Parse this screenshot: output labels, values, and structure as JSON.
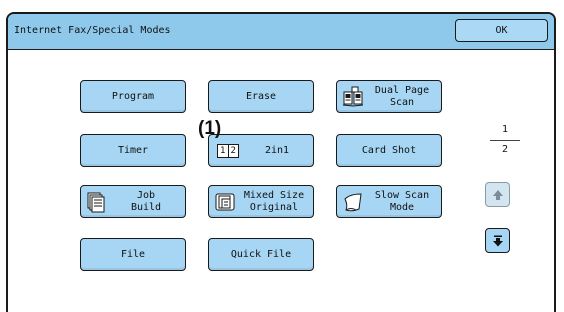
{
  "window": {
    "title": "Internet Fax/Special Modes",
    "ok_label": "OK"
  },
  "buttons": {
    "program": "Program",
    "erase": "Erase",
    "dual_page_scan": "Dual Page\nScan",
    "timer": "Timer",
    "twoin1": "2in1",
    "card_shot": "Card Shot",
    "job_build": "Job\nBuild",
    "mixed_size_original": "Mixed Size\nOriginal",
    "slow_scan_mode": "Slow Scan\nMode",
    "file": "File",
    "quick_file": "Quick File"
  },
  "twoin1_icon": {
    "left": "1",
    "right": "2"
  },
  "callout": "(1)",
  "pagination": {
    "current": "1",
    "total": "2",
    "up_enabled": false,
    "down_enabled": true
  },
  "icons": {
    "dual_page_scan": "open-book-icon",
    "twoin1": "two-in-one-icon",
    "job_build": "stacked-pages-icon",
    "mixed_size_original": "mixed-size-pages-icon",
    "slow_scan_mode": "thin-paper-icon",
    "scroll_up": "arrow-up-icon",
    "scroll_down": "arrow-down-icon"
  },
  "colors": {
    "titlebar": "#8ec9ec",
    "button": "#a6d6f3",
    "border": "#1a1a1a"
  }
}
